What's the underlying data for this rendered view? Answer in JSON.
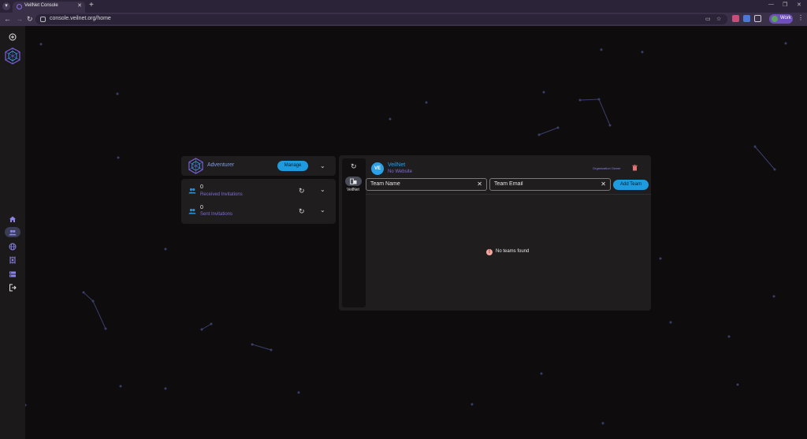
{
  "browser": {
    "tab_title": "VeilNet Console",
    "url": "console.veilnet.org/home",
    "profile_label": "Work",
    "colors": {
      "chrome_bg": "#2b2338",
      "toolbar_bg": "#3a3148",
      "profile_pill": "#6f4fb8"
    }
  },
  "sidebar": {
    "items": [
      {
        "icon": "plus-circle-icon",
        "active": false
      },
      {
        "icon": "veilnet-logo",
        "active": false
      },
      {
        "icon": "home-icon",
        "active": false
      },
      {
        "icon": "people-icon",
        "active": true
      },
      {
        "icon": "globe-icon",
        "active": false
      },
      {
        "icon": "chip-icon",
        "active": false
      },
      {
        "icon": "server-icon",
        "active": false
      },
      {
        "icon": "logout-icon",
        "active": false
      }
    ]
  },
  "account": {
    "name": "Adventurer",
    "manage_label": "Manage"
  },
  "invitations": {
    "received": {
      "count": "0",
      "label": "Received Invitations"
    },
    "sent": {
      "count": "0",
      "label": "Sent Invitations"
    }
  },
  "org_panel": {
    "rail_org_label": "VeilNet",
    "avatar_initials": "VE",
    "org_name": "VeilNet",
    "website": "No Website",
    "role": "Organization Owner",
    "team_name_placeholder": "Team Name",
    "team_email_placeholder": "Team Email",
    "add_team_label": "Add Team",
    "empty_message": "No teams found"
  },
  "colors": {
    "accent_blue": "#1e9bde",
    "accent_purple": "#8a82e6",
    "card_bg": "#1f1d1d",
    "page_bg": "#0e0c0c",
    "error_badge": "#f2a7a1",
    "delete_red": "#e57373"
  }
}
